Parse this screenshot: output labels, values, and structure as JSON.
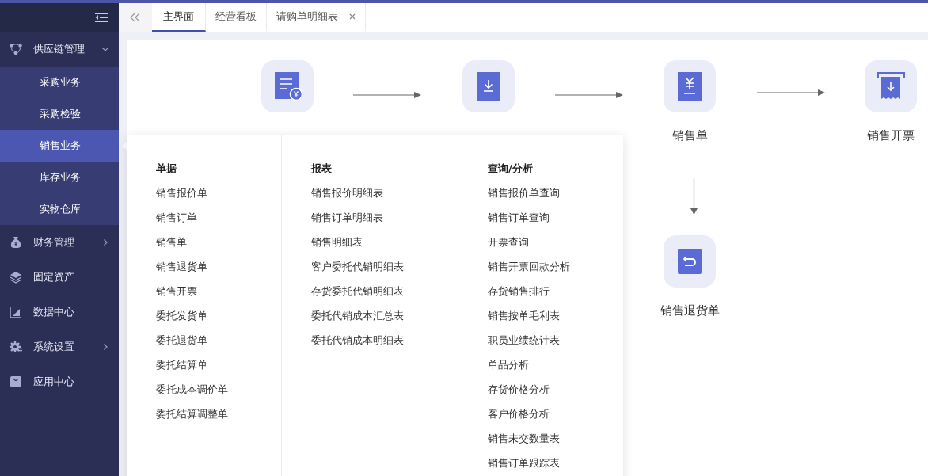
{
  "sidebar": {
    "items": [
      {
        "label": "供应链管理",
        "expanded": true,
        "children": [
          {
            "label": "采购业务",
            "selected": false
          },
          {
            "label": "采购检验",
            "selected": false
          },
          {
            "label": "销售业务",
            "selected": true
          },
          {
            "label": "库存业务",
            "selected": false
          },
          {
            "label": "实物仓库",
            "selected": false
          }
        ]
      },
      {
        "label": "财务管理",
        "expanded": false
      },
      {
        "label": "固定资产"
      },
      {
        "label": "数据中心"
      },
      {
        "label": "系统设置",
        "expanded": false
      },
      {
        "label": "应用中心"
      }
    ]
  },
  "tabs": [
    {
      "label": "主界面",
      "selected": true,
      "closable": false
    },
    {
      "label": "经营看板",
      "selected": false,
      "closable": false
    },
    {
      "label": "请购单明细表",
      "selected": false,
      "closable": true
    }
  ],
  "flow": {
    "nodes": [
      {
        "kind": "quote"
      },
      {
        "kind": "order"
      },
      {
        "label": "销售单",
        "kind": "sale"
      },
      {
        "label": "销售开票",
        "kind": "invoice"
      },
      {
        "label": "销售退货单",
        "kind": "return"
      }
    ]
  },
  "dropdown": {
    "columns": [
      {
        "title": "单据",
        "items": [
          "销售报价单",
          "销售订单",
          "销售单",
          "销售退货单",
          "销售开票",
          "委托发货单",
          "委托退货单",
          "委托结算单",
          "委托成本调价单",
          "委托结算调整单"
        ]
      },
      {
        "title": "报表",
        "items": [
          "销售报价明细表",
          "销售订单明细表",
          "销售明细表",
          "客户委托代销明细表",
          "存货委托代销明细表",
          "委托代销成本汇总表",
          "委托代销成本明细表"
        ]
      },
      {
        "title": "查询/分析",
        "items": [
          "销售报价单查询",
          "销售订单查询",
          "开票查询",
          "销售开票回款分析",
          "存货销售排行",
          "销售按单毛利表",
          "职员业绩统计表",
          "单品分析",
          "存货价格分析",
          "客户价格分析",
          "销售未交数量表",
          "销售订单跟踪表"
        ]
      }
    ]
  }
}
